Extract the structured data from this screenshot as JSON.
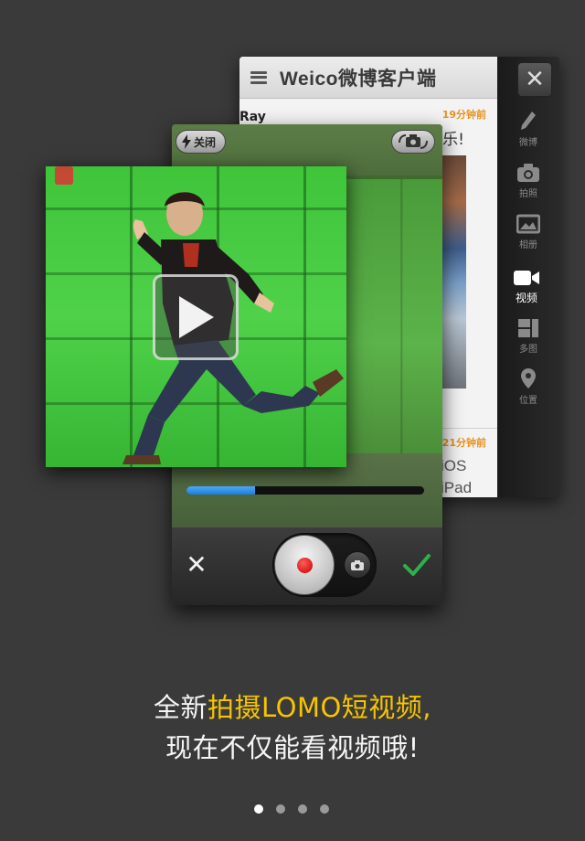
{
  "app": {
    "title": "Weico微博客户端",
    "feed": {
      "author": "Ray",
      "time1": "19分钟前",
      "text1": "乐!",
      "time2": "21分钟前",
      "text2a": "iOS",
      "text2b": "iPad"
    },
    "sidebar": [
      {
        "id": "weibo",
        "label": "微博",
        "icon": "pencil-icon"
      },
      {
        "id": "photo",
        "label": "拍照",
        "icon": "camera-icon"
      },
      {
        "id": "album",
        "label": "相册",
        "icon": "album-icon"
      },
      {
        "id": "video",
        "label": "视频",
        "icon": "video-camera-icon",
        "active": true
      },
      {
        "id": "multi",
        "label": "多图",
        "icon": "grid-icon"
      },
      {
        "id": "location",
        "label": "位置",
        "icon": "location-pin-icon"
      }
    ]
  },
  "camera": {
    "flash_label": "关闭",
    "progress": 0.29,
    "progress_color": "#2a8cf0",
    "record_color": "#d00000",
    "confirm_color": "#2bb24c"
  },
  "caption": {
    "line1_prefix": "全新",
    "line1_highlight": "拍摄LOMO短视频,",
    "line2": "现在不仅能看视频哦!",
    "highlight_color": "#f6c400"
  },
  "pager": {
    "total": 4,
    "current": 1
  }
}
